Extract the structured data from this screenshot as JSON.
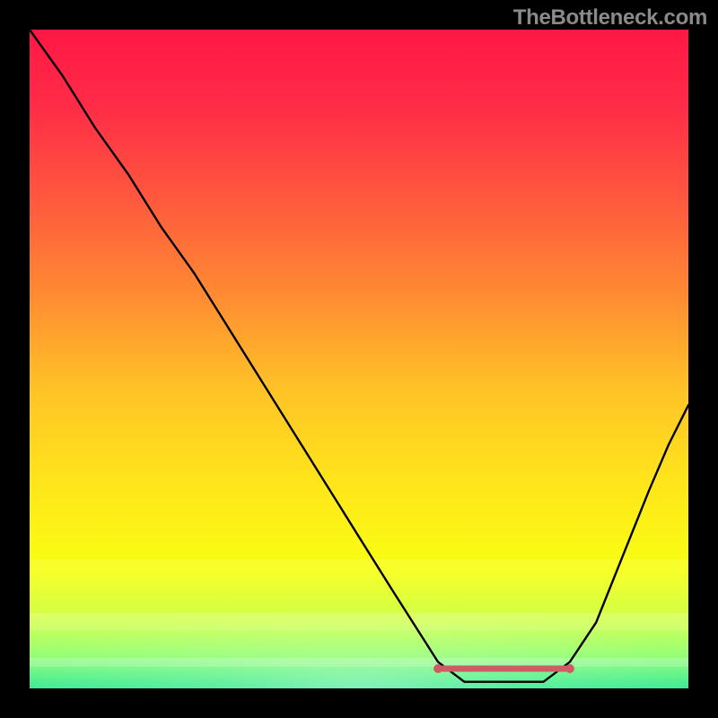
{
  "watermark": {
    "text": "TheBottleneck.com"
  },
  "gradient": {
    "stops": [
      {
        "offset": 0.0,
        "color": "#ff1744"
      },
      {
        "offset": 0.12,
        "color": "#ff2d47"
      },
      {
        "offset": 0.25,
        "color": "#ff563e"
      },
      {
        "offset": 0.4,
        "color": "#ff8a33"
      },
      {
        "offset": 0.55,
        "color": "#ffc426"
      },
      {
        "offset": 0.7,
        "color": "#ffe81a"
      },
      {
        "offset": 0.82,
        "color": "#f7ff12"
      },
      {
        "offset": 0.9,
        "color": "#c8ff33"
      },
      {
        "offset": 0.95,
        "color": "#7dff55"
      },
      {
        "offset": 1.0,
        "color": "#00e676"
      }
    ]
  },
  "chart_data": {
    "type": "line",
    "title": "",
    "xlabel": "",
    "ylabel": "",
    "xlim_commentary": "x is position across plot (0..1); y is bottleneck severity metric, 0 = green band, 1 = top/red",
    "xlim": [
      0,
      1
    ],
    "ylim": [
      0,
      1
    ],
    "series": [
      {
        "name": "bottleneck-curve",
        "data": [
          {
            "x": 0.0,
            "y": 1.0
          },
          {
            "x": 0.05,
            "y": 0.93
          },
          {
            "x": 0.1,
            "y": 0.85
          },
          {
            "x": 0.15,
            "y": 0.78
          },
          {
            "x": 0.2,
            "y": 0.7
          },
          {
            "x": 0.25,
            "y": 0.63
          },
          {
            "x": 0.3,
            "y": 0.55
          },
          {
            "x": 0.35,
            "y": 0.47
          },
          {
            "x": 0.4,
            "y": 0.39
          },
          {
            "x": 0.45,
            "y": 0.31
          },
          {
            "x": 0.5,
            "y": 0.23
          },
          {
            "x": 0.55,
            "y": 0.15
          },
          {
            "x": 0.62,
            "y": 0.04
          },
          {
            "x": 0.66,
            "y": 0.01
          },
          {
            "x": 0.7,
            "y": 0.01
          },
          {
            "x": 0.74,
            "y": 0.01
          },
          {
            "x": 0.78,
            "y": 0.01
          },
          {
            "x": 0.82,
            "y": 0.04
          },
          {
            "x": 0.86,
            "y": 0.1
          },
          {
            "x": 0.9,
            "y": 0.2
          },
          {
            "x": 0.94,
            "y": 0.3
          },
          {
            "x": 0.97,
            "y": 0.37
          },
          {
            "x": 1.0,
            "y": 0.43
          }
        ]
      }
    ],
    "highlight_band": {
      "name": "optimal-range-marker",
      "x_start": 0.62,
      "x_end": 0.82,
      "y": 0.03,
      "color": "#cf5b64"
    }
  }
}
